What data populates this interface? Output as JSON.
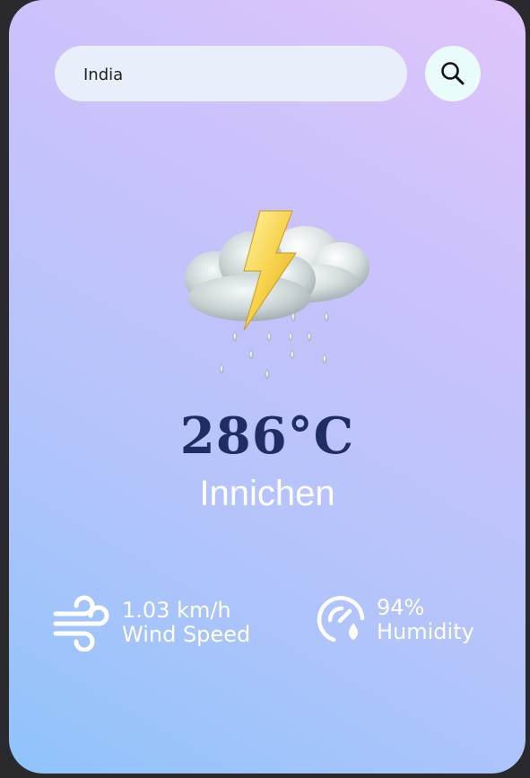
{
  "search": {
    "value": "India",
    "icon": "search-icon"
  },
  "weather": {
    "icon": "thunderstorm-rain-icon",
    "temperature": "286°C",
    "city": "Innichen"
  },
  "stats": {
    "wind": {
      "icon": "wind-icon",
      "value": "1.03 km/h",
      "label": "Wind Speed"
    },
    "humidity": {
      "icon": "humidity-gauge-icon",
      "value": "94%",
      "label": "Humidity"
    }
  },
  "colors": {
    "temperature": "#1f2d64",
    "search_bar": "#e8eefa",
    "search_button": "#e9fbfb"
  }
}
